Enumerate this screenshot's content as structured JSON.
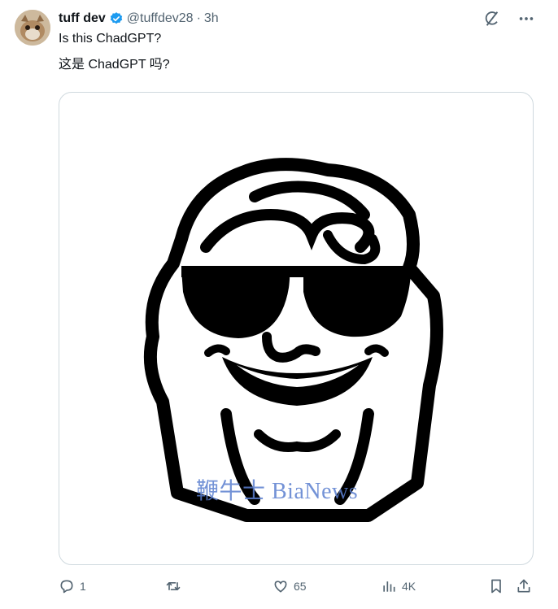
{
  "tweet": {
    "display_name": "tuff dev",
    "handle": "@tuffdev28",
    "separator": "·",
    "time": "3h",
    "text_en": "Is this ChadGPT?",
    "text_zh": "这是 ChadGPT 吗?"
  },
  "media": {
    "watermark": "鞭牛士 BiaNews"
  },
  "actions": {
    "replies": "1",
    "retweets": "",
    "likes": "65",
    "views": "4K"
  },
  "colors": {
    "text_primary": "#0f1419",
    "text_secondary": "#536471",
    "verified": "#1d9bf0",
    "border": "#cfd9de"
  },
  "icons": [
    "grok-icon",
    "more-icon",
    "reply-icon",
    "retweet-icon",
    "like-icon",
    "views-icon",
    "bookmark-icon",
    "share-icon",
    "verified-badge-icon"
  ]
}
